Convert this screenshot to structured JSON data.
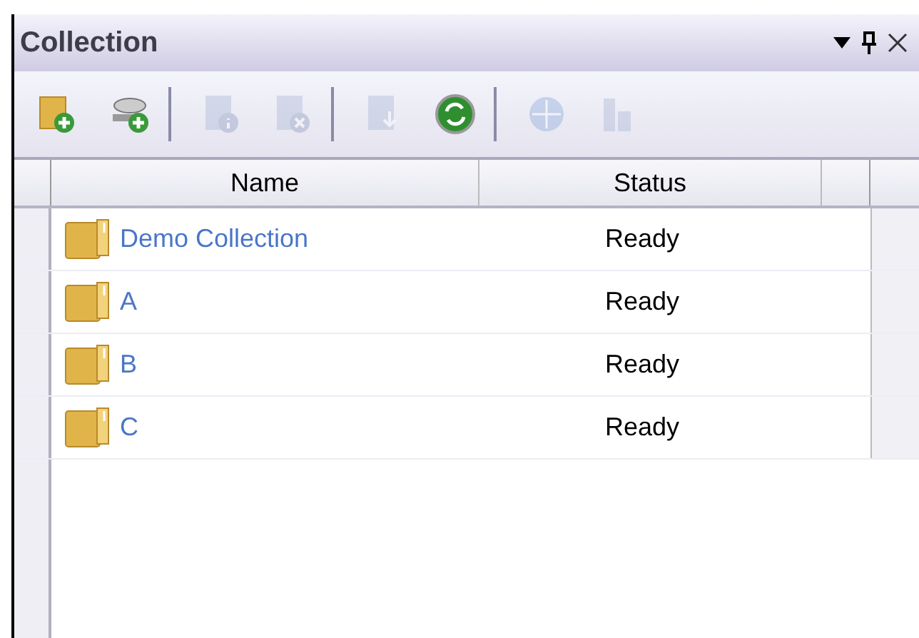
{
  "panel": {
    "title": "Collection"
  },
  "toolbar": {
    "groups": [
      [
        {
          "disabled": false
        },
        {
          "disabled": false
        }
      ],
      [
        {
          "disabled": true
        },
        {
          "disabled": true
        }
      ],
      [
        {
          "disabled": true
        },
        {
          "disabled": false
        }
      ],
      [
        {
          "disabled": true
        },
        {
          "disabled": true
        }
      ]
    ]
  },
  "table": {
    "columns": [
      "Name",
      "Status"
    ],
    "rows": [
      {
        "name": "Demo Collection",
        "status": "Ready"
      },
      {
        "name": "A",
        "status": "Ready"
      },
      {
        "name": "B",
        "status": "Ready"
      },
      {
        "name": "C",
        "status": "Ready"
      }
    ]
  }
}
